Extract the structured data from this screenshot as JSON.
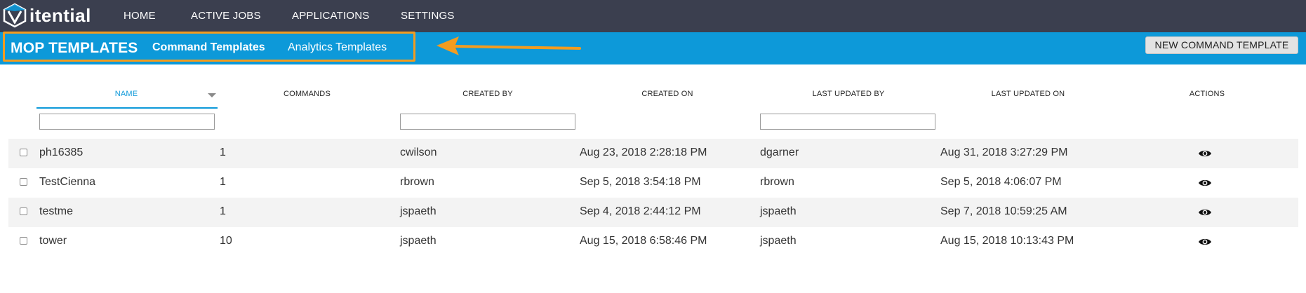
{
  "app": {
    "logo_text": "itential"
  },
  "nav": [
    {
      "label": "HOME"
    },
    {
      "label": "ACTIVE JOBS"
    },
    {
      "label": "APPLICATIONS"
    },
    {
      "label": "SETTINGS"
    }
  ],
  "subnav": {
    "title": "MOP TEMPLATES",
    "tabs": [
      {
        "label": "Command Templates",
        "active": true
      },
      {
        "label": "Analytics Templates",
        "active": false
      }
    ],
    "new_button": "NEW COMMAND TEMPLATE"
  },
  "colors": {
    "nav_bg": "#3b3f4f",
    "accent": "#0d99d9",
    "highlight": "#f39c1f"
  },
  "table": {
    "columns": [
      "NAME",
      "COMMANDS",
      "CREATED BY",
      "CREATED ON",
      "LAST UPDATED BY",
      "LAST UPDATED ON",
      "ACTIONS"
    ],
    "sorted_column": "NAME",
    "filters": {
      "name": "",
      "created_by": "",
      "last_updated_by": ""
    },
    "rows": [
      {
        "name": "ph16385",
        "commands": "1",
        "created_by": "cwilson",
        "created_on": "Aug 23, 2018 2:28:18 PM",
        "last_updated_by": "dgarner",
        "last_updated_on": "Aug 31, 2018 3:27:29 PM",
        "action_icon": "eye-icon"
      },
      {
        "name": "TestCienna",
        "commands": "1",
        "created_by": "rbrown",
        "created_on": "Sep 5, 2018 3:54:18 PM",
        "last_updated_by": "rbrown",
        "last_updated_on": "Sep 5, 2018 4:06:07 PM",
        "action_icon": "eye-icon"
      },
      {
        "name": "testme",
        "commands": "1",
        "created_by": "jspaeth",
        "created_on": "Sep 4, 2018 2:44:12 PM",
        "last_updated_by": "jspaeth",
        "last_updated_on": "Sep 7, 2018 10:59:25 AM",
        "action_icon": "eye-icon"
      },
      {
        "name": "tower",
        "commands": "10",
        "created_by": "jspaeth",
        "created_on": "Aug 15, 2018 6:58:46 PM",
        "last_updated_by": "jspaeth",
        "last_updated_on": "Aug 15, 2018 10:13:43 PM",
        "action_icon": "eye-icon"
      }
    ]
  }
}
